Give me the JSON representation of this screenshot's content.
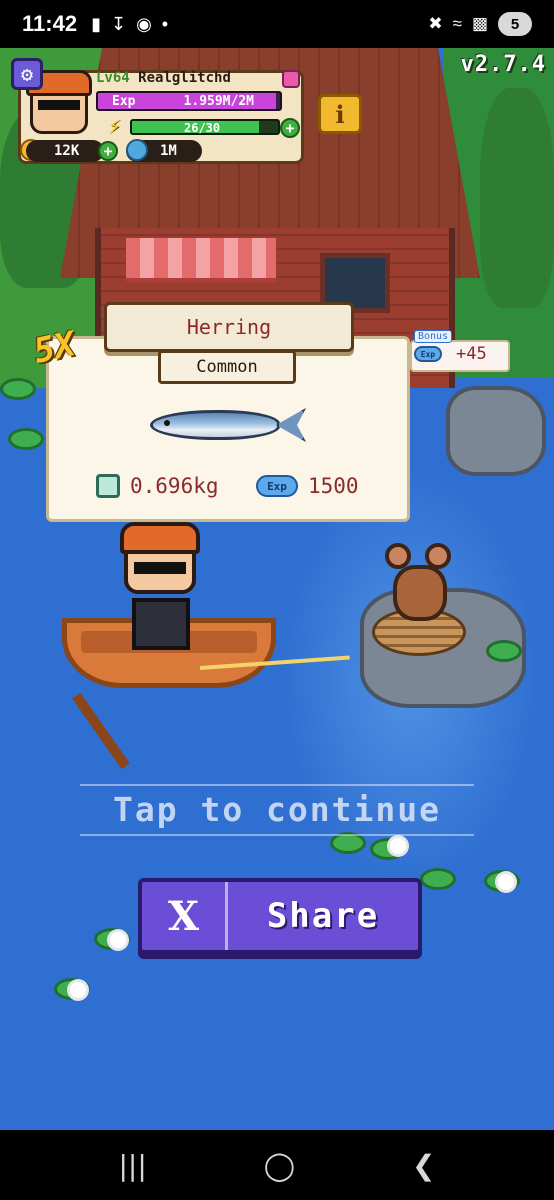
{
  "status_bar": {
    "time": "11:42",
    "battery": "5"
  },
  "hud": {
    "version": "v2.7.4",
    "level": "Lv64",
    "player_name": "Realglitchd",
    "exp_label": "Exp",
    "exp_value": "1.959M/2M",
    "exp_fraction": 0.98,
    "energy_value": "26/30",
    "energy_fraction": 0.867,
    "coins": "12K",
    "gems": "1M",
    "info_label": "i"
  },
  "catch": {
    "multiplier": "5X",
    "fish_name": "Herring",
    "rarity": "Common",
    "weight": "0.696kg",
    "exp_badge": "Exp",
    "exp_reward": "1500",
    "bonus_label": "Bonus",
    "bonus_badge": "Exp",
    "bonus_value": "+45"
  },
  "prompt": {
    "tap_text": "Tap to continue"
  },
  "share": {
    "icon": "X",
    "label": "Share"
  },
  "icons": {
    "settings": "gear-icon",
    "info": "info-icon",
    "coin": "coin-icon",
    "gem": "globe-icon",
    "energy": "lightning-icon",
    "scale": "scale-icon",
    "share": "x-logo-icon"
  },
  "colors": {
    "water": "#2f6fd1",
    "share_button": "#6b4ed6",
    "exp_bar": "#c944d8",
    "energy_bar": "#3fc24f",
    "fish_name": "#8a2a2a"
  }
}
